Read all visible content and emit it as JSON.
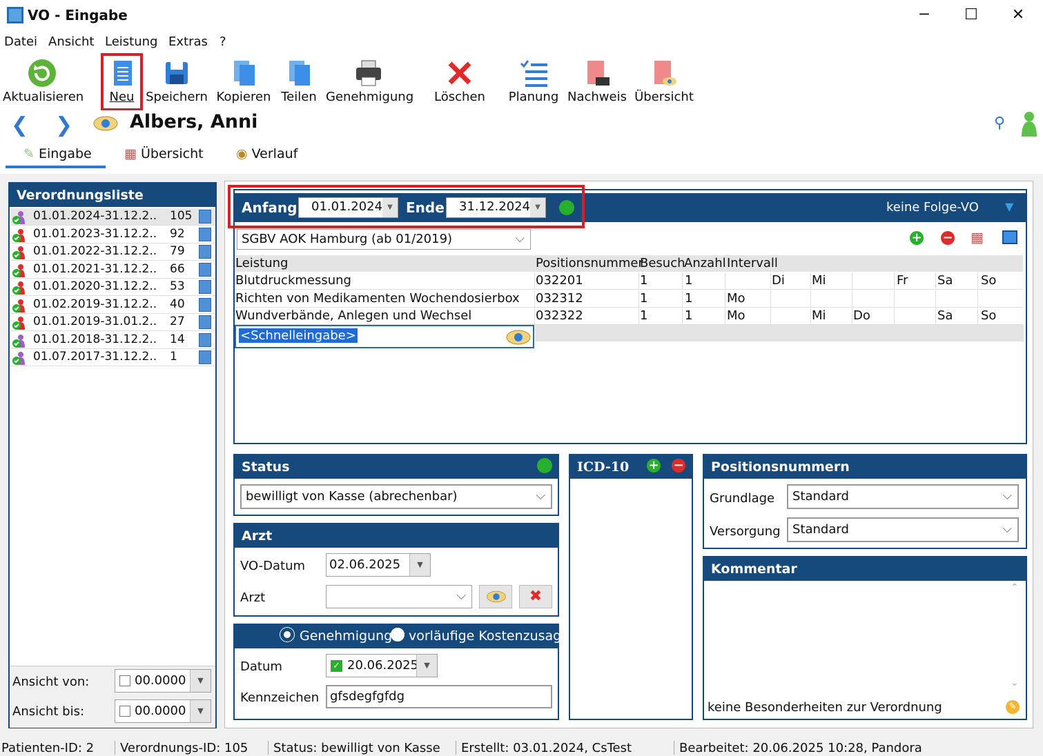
{
  "window": {
    "title": "VO - Eingabe"
  },
  "menu": [
    "Datei",
    "Ansicht",
    "Leistung",
    "Extras",
    "?"
  ],
  "toolbar": {
    "aktualisieren": "Aktualisieren",
    "neu": "Neu",
    "speichern": "Speichern",
    "kopieren": "Kopieren",
    "teilen": "Teilen",
    "genehmigung": "Genehmigung",
    "loeschen": "Löschen",
    "planung": "Planung",
    "nachweis": "Nachweis",
    "uebersicht": "Übersicht"
  },
  "patient": {
    "name": "Albers, Anni"
  },
  "tabs": [
    "Eingabe",
    "Übersicht",
    "Verlauf"
  ],
  "verordnungsliste": {
    "title": "Verordnungsliste",
    "items": [
      {
        "range": "01.01.2024-31.12.2..",
        "num": "105",
        "icon": "person-purple"
      },
      {
        "range": "01.01.2023-31.12.2..",
        "num": "92",
        "icon": "person-red"
      },
      {
        "range": "01.01.2022-31.12.2..",
        "num": "79",
        "icon": "person-red"
      },
      {
        "range": "01.01.2021-31.12.2..",
        "num": "66",
        "icon": "person-red"
      },
      {
        "range": "01.01.2020-31.12.2..",
        "num": "53",
        "icon": "person-red"
      },
      {
        "range": "01.02.2019-31.12.2..",
        "num": "40",
        "icon": "person-red"
      },
      {
        "range": "01.01.2019-31.01.2..",
        "num": "27",
        "icon": "person-red"
      },
      {
        "range": "01.01.2018-31.12.2..",
        "num": "14",
        "icon": "person-purple"
      },
      {
        "range": "01.07.2017-31.12.2..",
        "num": "1",
        "icon": "person-purple"
      }
    ],
    "ansicht_von_label": "Ansicht von:",
    "ansicht_von_value": "00.0000",
    "ansicht_bis_label": "Ansicht bis:",
    "ansicht_bis_value": "00.0000"
  },
  "vo": {
    "anfang_label": "Anfang",
    "anfang_value": "01.01.2024",
    "ende_label": "Ende",
    "ende_value": "31.12.2024",
    "folge": "keine Folge-VO",
    "kasse": "SGBV AOK Hamburg (ab 01/2019)"
  },
  "grid": {
    "headers": [
      "Leistung",
      "Positionsnummer",
      "Besuch",
      "Anzahl",
      "Intervall"
    ],
    "rows": [
      {
        "leistung": "Blutdruckmessung",
        "pos": "032201",
        "besuch": "1",
        "anzahl": "1",
        "days": [
          "",
          "Di",
          "Mi",
          "",
          "Fr",
          "Sa",
          "So"
        ]
      },
      {
        "leistung": "Richten von Medikamenten Wochendosierbox",
        "pos": "032312",
        "besuch": "1",
        "anzahl": "1",
        "days": [
          "Mo",
          "",
          "",
          "",
          "",
          "",
          ""
        ]
      },
      {
        "leistung": "Wundverbände, Anlegen und Wechsel",
        "pos": "032322",
        "besuch": "1",
        "anzahl": "1",
        "days": [
          "Mo",
          "",
          "Mi",
          "Do",
          "",
          "Sa",
          "So"
        ]
      }
    ],
    "schnelleingabe": "<Schnelleingabe>"
  },
  "status": {
    "title": "Status",
    "value": "bewilligt von Kasse (abrechenbar)"
  },
  "arzt": {
    "title": "Arzt",
    "vo_datum_label": "VO-Datum",
    "vo_datum_value": "02.06.2025",
    "arzt_label": "Arzt",
    "arzt_value": ""
  },
  "genehmigung": {
    "radio1": "Genehmigung",
    "radio2": "vorläufige Kostenzusage",
    "datum_label": "Datum",
    "datum_value": "20.06.2025",
    "kennzeichen_label": "Kennzeichen",
    "kennzeichen_value": "gfsdegfgfdg"
  },
  "icd": {
    "title": "ICD-10"
  },
  "positionsnummern": {
    "title": "Positionsnummern",
    "grundlage_label": "Grundlage",
    "grundlage_value": "Standard",
    "versorgung_label": "Versorgung",
    "versorgung_value": "Standard"
  },
  "kommentar": {
    "title": "Kommentar",
    "text": "keine Besonderheiten zur Verordnung"
  },
  "statusbar": {
    "patient_id": "Patienten-ID: 2",
    "vo_id": "Verordnungs-ID: 105",
    "status": "Status: bewilligt von Kasse",
    "erstellt": "Erstellt: 03.01.2024, CsTest",
    "bearbeitet": "Bearbeitet: 20.06.2025 10:28, Pandora"
  },
  "colors": {
    "accent": "#174a7c",
    "highlight": "#d61f26",
    "ok": "#27b02b"
  }
}
